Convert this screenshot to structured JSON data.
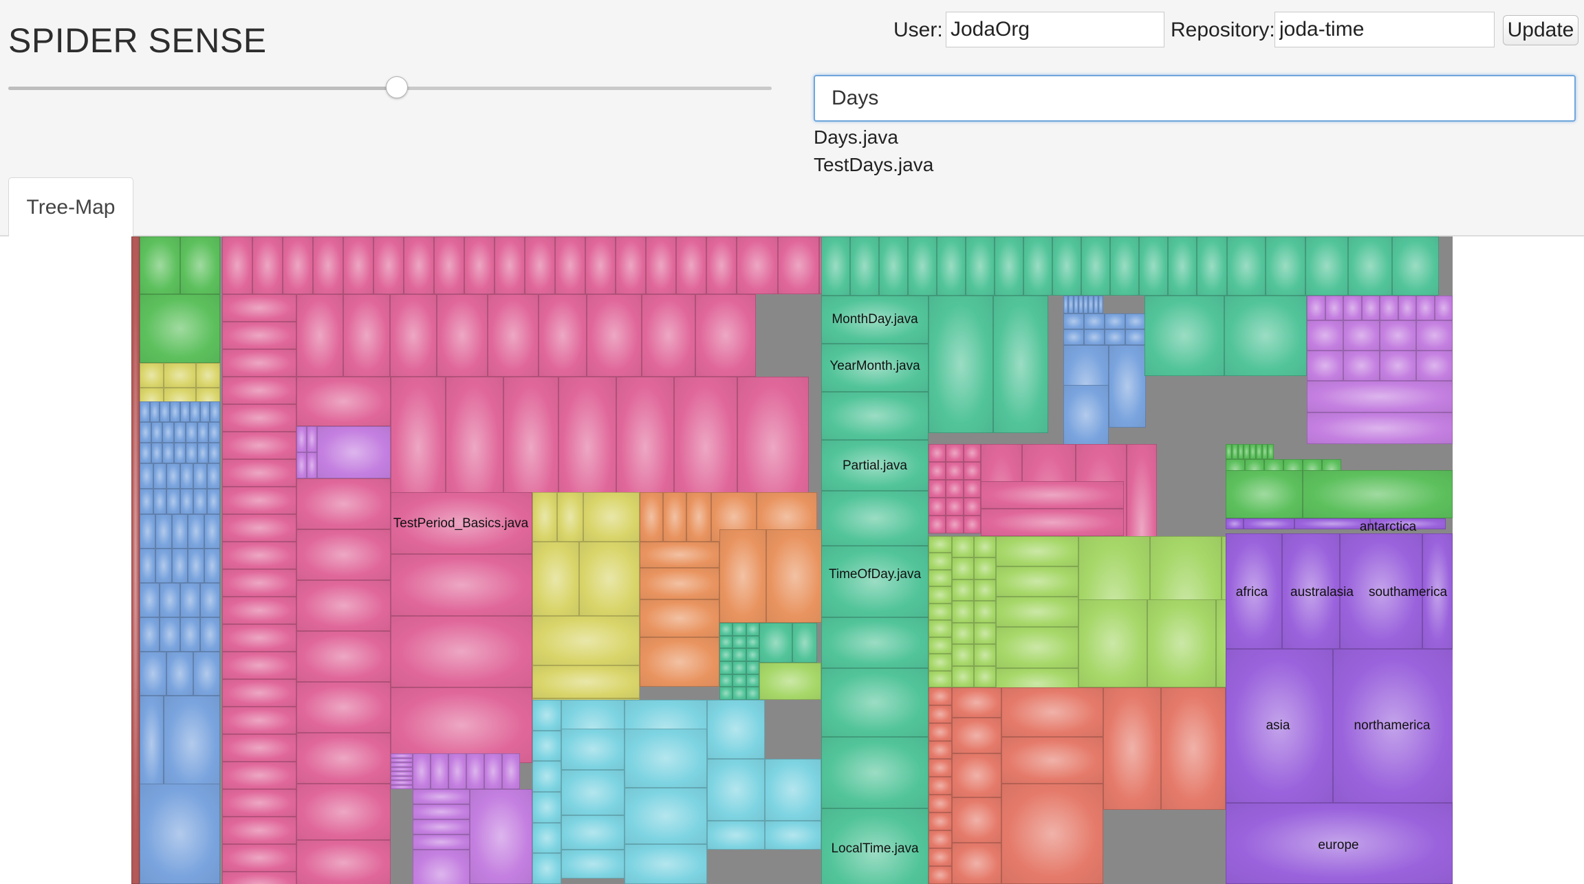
{
  "app": {
    "title": "SPIDER SENSE"
  },
  "controls": {
    "user_label": "User:",
    "user_value": "JodaOrg",
    "repo_label": "Repository:",
    "repo_value": "joda-time",
    "update_label": "Update"
  },
  "slider": {
    "value_fraction": 0.508
  },
  "search": {
    "value": "Days",
    "results": [
      "Days.java",
      "TestDays.java"
    ]
  },
  "tabs": [
    {
      "label": "Tree-Map",
      "active": true
    }
  ],
  "treemap": {
    "palette": {
      "green": "#5cc05c",
      "yellow": "#d9d56a",
      "blue": "#7aa4de",
      "pink": "#e0679a",
      "violet": "#c47fe0",
      "orange": "#e99460",
      "cyan": "#7ed4e2",
      "teal": "#52c49a",
      "lime": "#a6d768",
      "salmon": "#e57a6a",
      "purple": "#9a62dc",
      "brown": "#b85a5a"
    },
    "labels": {
      "month_day": "MonthDay.java",
      "year_month": "YearMonth.java",
      "partial": "Partial.java",
      "time_of_day": "TimeOfDay.java",
      "local_time": "LocalTime.java",
      "test_period_basics": "TestPeriod_Basics.java",
      "antarctica": "antarctica",
      "africa": "africa",
      "australasia": "australasia",
      "southamerica": "southamerica",
      "asia": "asia",
      "northamerica": "northamerica",
      "europe": "europe"
    }
  }
}
